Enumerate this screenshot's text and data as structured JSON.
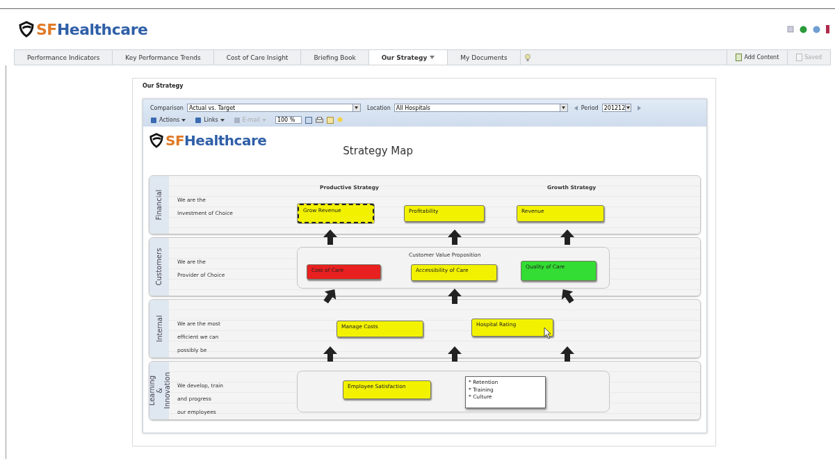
{
  "header_brand": {
    "prefix": "SF",
    "name": "Healthcare"
  },
  "nav": {
    "tabs": [
      {
        "label": "Performance Indicators",
        "selected": false,
        "dropdown": false
      },
      {
        "label": "Key Performance Trends",
        "selected": false,
        "dropdown": false
      },
      {
        "label": "Cost of Care Insight",
        "selected": false,
        "dropdown": false
      },
      {
        "label": "Briefing Book",
        "selected": false,
        "dropdown": false
      },
      {
        "label": "Our Strategy",
        "selected": true,
        "dropdown": true
      },
      {
        "label": "My Documents",
        "selected": false,
        "dropdown": false
      }
    ],
    "actions": [
      {
        "label": "Add Content",
        "disabled": false
      },
      {
        "label": "Saved",
        "disabled": true
      }
    ]
  },
  "panel": {
    "title": "Our Strategy",
    "filters": [
      {
        "label": "Comparison",
        "value": "Actual vs. Target"
      },
      {
        "label": "Location",
        "value": "All Hospitals"
      },
      {
        "label": "Period",
        "value": "201212"
      }
    ],
    "toolbar": [
      {
        "label": "Actions",
        "disabled": false
      },
      {
        "label": "Links",
        "disabled": false
      },
      {
        "label": "E-mail",
        "disabled": true
      }
    ],
    "zoom": "100 %",
    "map_brand": {
      "prefix": "SF",
      "name": "Healthcare"
    },
    "map": {
      "title": "Strategy Map",
      "lanes": [
        {
          "label": "Financial",
          "description": "We are the\nInvestment of Choice",
          "grouped": false,
          "headings": [
            "Productive Strategy",
            "Growth Strategy"
          ],
          "nodes": [
            {
              "label": "Grow Revenue",
              "color": "#f2f200",
              "selected": true
            },
            {
              "label": "Profitability",
              "color": "#f2f200",
              "selected": false
            },
            {
              "label": "Revenue",
              "color": "#f2f200",
              "selected": false
            }
          ]
        },
        {
          "label": "Customers",
          "description": "We are the\nProvider of Choice",
          "grouped": true,
          "group_title": "Customer Value Proposition",
          "nodes": [
            {
              "label": "Cost of Care",
              "color": "#e82020",
              "selected": false
            },
            {
              "label": "Accessibility of Care",
              "color": "#f2f200",
              "selected": false
            },
            {
              "label": "Quality of Care",
              "color": "#33dd33",
              "selected": false
            }
          ]
        },
        {
          "label": "Internal",
          "description": "We are the most\nefficient we can\npossibly be",
          "grouped": false,
          "nodes": [
            {
              "label": "Manage Costs",
              "color": "#f2f200",
              "selected": false
            },
            {
              "label": "Hospital Rating",
              "color": "#f2f200",
              "selected": false
            }
          ]
        },
        {
          "label": "Learning & Innovation",
          "description": "We develop, train\nand progress\nour employees",
          "grouped": true,
          "nodes": [
            {
              "label": "Employee Satisfaction",
              "color": "#f2f200",
              "selected": false
            }
          ],
          "note": [
            "* Retention",
            "* Training",
            "* Culture"
          ]
        }
      ]
    }
  }
}
